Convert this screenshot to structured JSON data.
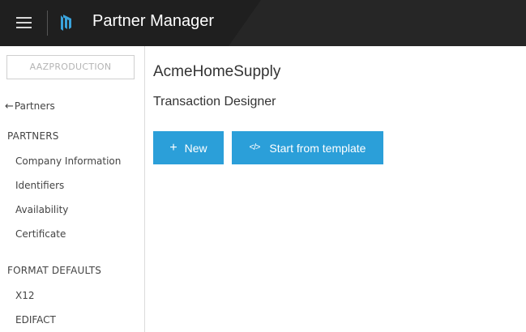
{
  "header": {
    "app_title": "Partner Manager",
    "menu_icon": "hamburger-icon",
    "logo_icon": "partner-manager-logo-icon"
  },
  "sidebar": {
    "environment": "AAZPRODUCTION",
    "back_link": "Partners",
    "back_icon": "arrow-left-icon",
    "sections": [
      {
        "heading": "PARTNERS",
        "items": [
          "Company Information",
          "Identifiers",
          "Availability",
          "Certificate"
        ]
      },
      {
        "heading": "FORMAT DEFAULTS",
        "items": [
          "X12",
          "EDIFACT"
        ]
      }
    ]
  },
  "main": {
    "title": "AcmeHomeSupply",
    "subtitle": "Transaction Designer",
    "buttons": {
      "new_label": "New",
      "new_icon": "plus-icon",
      "template_label": "Start from template",
      "template_icon": "code-icon"
    }
  },
  "colors": {
    "header_bg": "#262626",
    "header_dark": "#1f1f1f",
    "accent": "#2b9fd9",
    "logo_blue": "#3aa3dc"
  }
}
